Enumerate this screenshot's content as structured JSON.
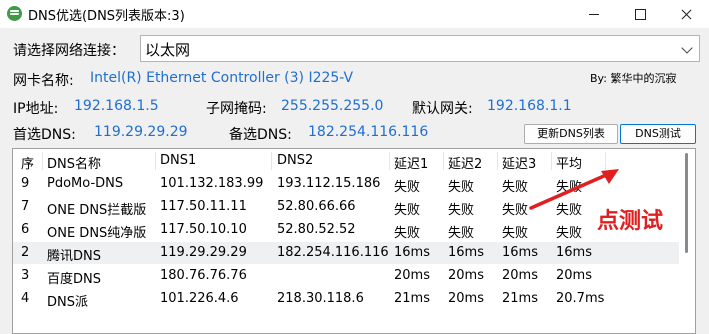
{
  "window": {
    "title": "DNS优选(DNS列表版本:3)"
  },
  "form": {
    "adapter_select_label": "请选择网络连接：",
    "adapter_select_value": "以太网",
    "nic_name_label": "网卡名称:",
    "nic_name_value": "Intel(R) Ethernet Controller (3) I225-V",
    "credit": "By: 繁华中的沉寂",
    "ip_label": "IP地址:",
    "ip_value": "192.168.1.5",
    "mask_label": "子网掩码:",
    "mask_value": "255.255.255.0",
    "gateway_label": "默认网关:",
    "gateway_value": "192.168.1.1",
    "primary_dns_label": "首选DNS:",
    "primary_dns_value": "119.29.29.29",
    "secondary_dns_label": "备选DNS:",
    "secondary_dns_value": "182.254.116.116",
    "update_button": "更新DNS列表",
    "test_button": "DNS测试"
  },
  "table": {
    "headers": [
      "序",
      "DNS名称",
      "DNS1",
      "DNS2",
      "延迟1",
      "延迟2",
      "延迟3",
      "平均"
    ],
    "rows": [
      [
        "9",
        "PdoMo-DNS",
        "101.132.183.99",
        "193.112.15.186",
        "失败",
        "失败",
        "失败",
        "失败"
      ],
      [
        "7",
        "ONE DNS拦截版",
        "117.50.11.11",
        "52.80.66.66",
        "失败",
        "失败",
        "失败",
        "失败"
      ],
      [
        "6",
        "ONE DNS纯净版",
        "117.50.10.10",
        "52.80.52.52",
        "失败",
        "失败",
        "失败",
        "失败"
      ],
      [
        "2",
        "腾讯DNS",
        "119.29.29.29",
        "182.254.116.116",
        "16ms",
        "16ms",
        "16ms",
        "16ms"
      ],
      [
        "3",
        "百度DNS",
        "180.76.76.76",
        "",
        "20ms",
        "20ms",
        "20ms",
        "20ms"
      ],
      [
        "4",
        "DNS派",
        "101.226.4.6",
        "218.30.118.6",
        "21ms",
        "20ms",
        "21ms",
        "20.7ms"
      ]
    ],
    "selected_row": 3
  },
  "annotation": {
    "text": "点测试",
    "color": "#e02020"
  },
  "colors": {
    "value_text": "#1e6fd0",
    "client_bg": "#f0f0f0"
  }
}
